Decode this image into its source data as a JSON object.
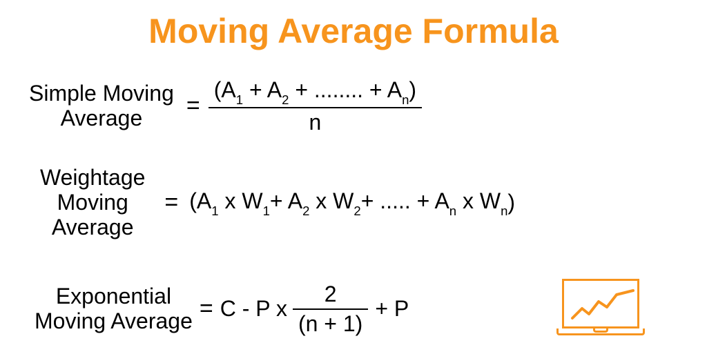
{
  "title": "Moving Average Formula",
  "colors": {
    "accent": "#f7941d",
    "text": "#000000"
  },
  "formulas": {
    "sma": {
      "label_line1": "Simple Moving",
      "label_line2": "Average",
      "numerator_prefix": "(A",
      "numerator_mid1": "+ A",
      "numerator_dots": "+ ........ + A",
      "numerator_suffix": ")",
      "sub1": "1",
      "sub2": "2",
      "subn": "n",
      "denominator": "n"
    },
    "wma": {
      "label_line1": "Weightage",
      "label_line2": "Moving",
      "label_line3": "Average",
      "open": "(A",
      "xw": " x W",
      "plus_a": " + A",
      "dots": " + ..... + A",
      "close": ")",
      "sub1": "1",
      "sub2": "2",
      "subn": "n"
    },
    "ema": {
      "label_line1": "Exponential",
      "label_line2": "Moving Average",
      "lhs": "C - P x",
      "num": "2",
      "den": "(n + 1)",
      "rhs": "+ P"
    }
  },
  "equals": "="
}
